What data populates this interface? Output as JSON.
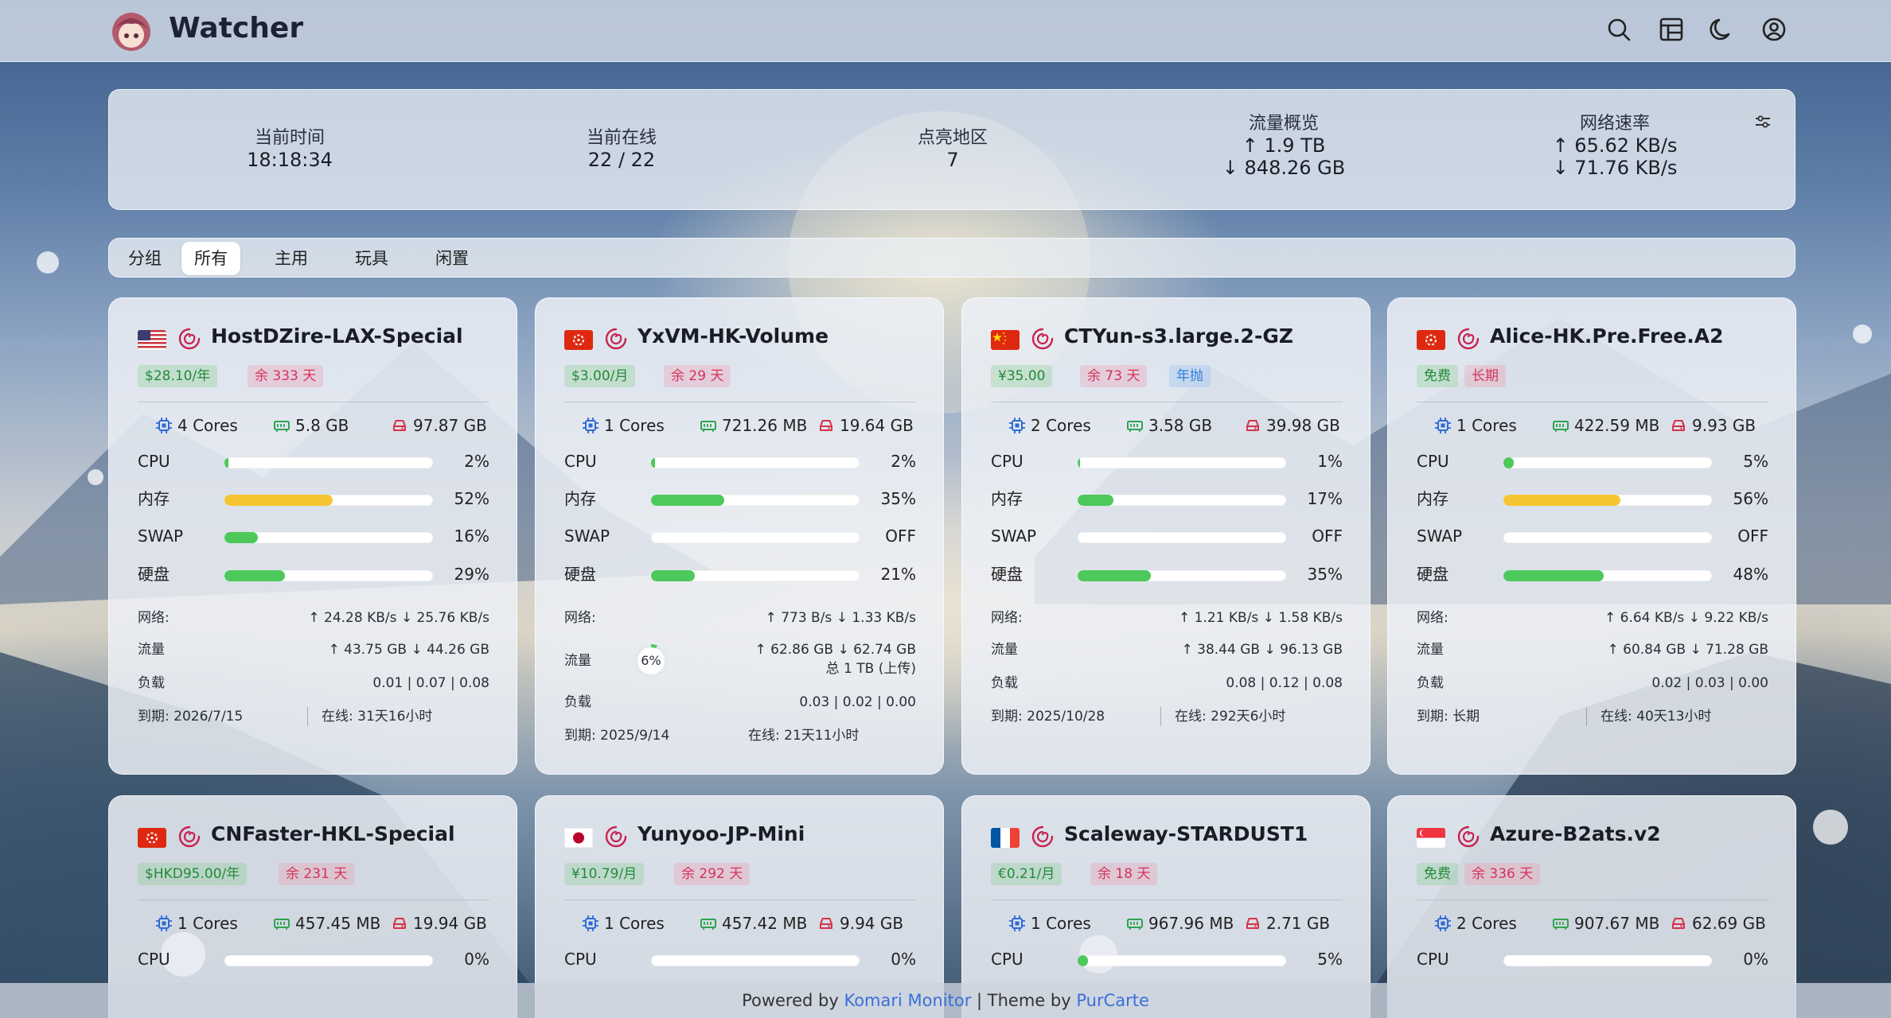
{
  "header": {
    "brand": "Watcher"
  },
  "overview": {
    "time_label": "当前时间",
    "time_value": "18:18:34",
    "online_label": "当前在线",
    "online_value": "22 / 22",
    "regions_label": "点亮地区",
    "regions_value": "7",
    "traffic_label": "流量概览",
    "traffic_up": "↑ 1.9 TB",
    "traffic_down": "↓ 848.26 GB",
    "speed_label": "网络速率",
    "speed_up": "↑ 65.62 KB/s",
    "speed_down": "↓ 71.76 KB/s"
  },
  "tabs": [
    {
      "label": "分组",
      "active": false
    },
    {
      "label": "所有",
      "active": true
    },
    {
      "label": "主用",
      "active": false
    },
    {
      "label": "玩具",
      "active": false
    },
    {
      "label": "闲置",
      "active": false
    }
  ],
  "labels": {
    "cpu": "CPU",
    "mem": "内存",
    "swap": "SWAP",
    "disk": "硬盘",
    "net": "网络:",
    "traffic": "流量",
    "load": "负载"
  },
  "colors": {
    "green": "#4cc95a",
    "yellow": "#f5c531",
    "accent": "#3a6fd8"
  },
  "cards": [
    {
      "flag": "us",
      "name": "HostDZire-LAX-Special",
      "badges": [
        {
          "text": "$28.10/年",
          "type": "price"
        },
        {
          "text": "余 333 天",
          "type": "remain"
        }
      ],
      "cores": "4 Cores",
      "mem": "5.8 GB",
      "disk": "97.87 GB",
      "cpu": {
        "pct": 2,
        "text": "2%"
      },
      "memu": {
        "pct": 52,
        "text": "52%",
        "color": "yellow"
      },
      "swap": {
        "pct": 16,
        "text": "16%"
      },
      "diskU": {
        "pct": 29,
        "text": "29%"
      },
      "net": "↑ 24.28 KB/s ↓ 25.76 KB/s",
      "traffic": "↑ 43.75 GB ↓ 44.26 GB",
      "load": "0.01 | 0.07 | 0.08",
      "expire": "到期:  2026/7/15",
      "uptime": "在线:  31天16小时"
    },
    {
      "flag": "hk",
      "name": "YxVM-HK-Volume",
      "badges": [
        {
          "text": "$3.00/月",
          "type": "price"
        },
        {
          "text": "余 29 天",
          "type": "remain"
        }
      ],
      "cores": "1 Cores",
      "mem": "721.26 MB",
      "disk": "19.64 GB",
      "cpu": {
        "pct": 2,
        "text": "2%"
      },
      "memu": {
        "pct": 35,
        "text": "35%"
      },
      "swap": {
        "pct": 0,
        "text": "OFF"
      },
      "diskU": {
        "pct": 21,
        "text": "21%"
      },
      "net": "↑ 773 B/s ↓ 1.33 KB/s",
      "traffic": "↑ 62.86 GB ↓ 62.74 GB",
      "traffic2": "总 1 TB (上传)",
      "quota_pct": "6%",
      "quota_value": 6,
      "load": "0.03 | 0.02 | 0.00",
      "expire": "到期:  2025/9/14",
      "uptime": "在线:  21天11小时"
    },
    {
      "flag": "cn",
      "name": "CTYun-s3.large.2-GZ",
      "badges": [
        {
          "text": "¥35.00",
          "type": "price"
        },
        {
          "text": "余 73 天",
          "type": "remain"
        },
        {
          "text": "年抛",
          "type": "blue"
        }
      ],
      "cores": "2 Cores",
      "mem": "3.58 GB",
      "disk": "39.98 GB",
      "cpu": {
        "pct": 1,
        "text": "1%"
      },
      "memu": {
        "pct": 17,
        "text": "17%"
      },
      "swap": {
        "pct": 0,
        "text": "OFF"
      },
      "diskU": {
        "pct": 35,
        "text": "35%"
      },
      "net": "↑ 1.21 KB/s ↓ 1.58 KB/s",
      "traffic": "↑ 38.44 GB ↓ 96.13 GB",
      "load": "0.08 | 0.12 | 0.08",
      "expire": "到期:  2025/10/28",
      "uptime": "在线:  292天6小时"
    },
    {
      "flag": "hk",
      "name": "Alice-HK.Pre.Free.A2",
      "badges": [
        {
          "text": "免费",
          "type": "price"
        },
        {
          "text": "长期",
          "type": "remain"
        }
      ],
      "cores": "1 Cores",
      "mem": "422.59 MB",
      "disk": "9.93 GB",
      "cpu": {
        "pct": 5,
        "text": "5%"
      },
      "memu": {
        "pct": 56,
        "text": "56%",
        "color": "yellow"
      },
      "swap": {
        "pct": 0,
        "text": "OFF"
      },
      "diskU": {
        "pct": 48,
        "text": "48%"
      },
      "net": "↑ 6.64 KB/s ↓ 9.22 KB/s",
      "traffic": "↑ 60.84 GB ↓ 71.28 GB",
      "load": "0.02 | 0.03 | 0.00",
      "expire": "到期:  长期",
      "uptime": "在线:  40天13小时"
    },
    {
      "flag": "hk",
      "name": "CNFaster-HKL-Special",
      "badges": [
        {
          "text": "$HKD95.00/年",
          "type": "price"
        },
        {
          "text": "余 231 天",
          "type": "remain"
        }
      ],
      "cores": "1 Cores",
      "mem": "457.45 MB",
      "disk": "19.94 GB",
      "cpu": {
        "pct": 0,
        "text": "0%"
      }
    },
    {
      "flag": "jp",
      "name": "Yunyoo-JP-Mini",
      "badges": [
        {
          "text": "¥10.79/月",
          "type": "price"
        },
        {
          "text": "余 292 天",
          "type": "remain"
        }
      ],
      "cores": "1 Cores",
      "mem": "457.42 MB",
      "disk": "9.94 GB",
      "cpu": {
        "pct": 0,
        "text": "0%"
      }
    },
    {
      "flag": "fr",
      "name": "Scaleway-STARDUST1",
      "badges": [
        {
          "text": "€0.21/月",
          "type": "price"
        },
        {
          "text": "余 18 天",
          "type": "remain"
        }
      ],
      "cores": "1 Cores",
      "mem": "967.96 MB",
      "disk": "2.71 GB",
      "cpu": {
        "pct": 5,
        "text": "5%"
      }
    },
    {
      "flag": "sg",
      "name": "Azure-B2ats.v2",
      "badges": [
        {
          "text": "免费",
          "type": "price"
        },
        {
          "text": "余 336 天",
          "type": "remain"
        }
      ],
      "cores": "2 Cores",
      "mem": "907.67 MB",
      "disk": "62.69 GB",
      "cpu": {
        "pct": 0,
        "text": "0%"
      }
    }
  ],
  "footer": {
    "powered": "Powered by",
    "komari": "Komari Monitor",
    "theme": " | Theme by",
    "purcarte": "PurCarte"
  }
}
